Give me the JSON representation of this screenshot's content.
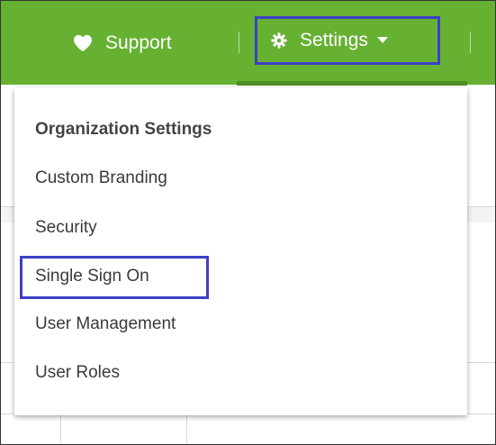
{
  "nav": {
    "support_label": "Support",
    "settings_label": "Settings"
  },
  "dropdown": {
    "header": "Organization Settings",
    "items": [
      {
        "label": "Custom Branding"
      },
      {
        "label": "Security"
      },
      {
        "label": "Single Sign On"
      },
      {
        "label": "User Management"
      },
      {
        "label": "User Roles"
      }
    ]
  },
  "colors": {
    "topbar": "#66b132",
    "highlight": "#3d40c7",
    "text": "#3a3a3a"
  },
  "icons": {
    "support": "heart-icon",
    "settings": "gear-icon",
    "dropdown": "caret-down-icon"
  }
}
